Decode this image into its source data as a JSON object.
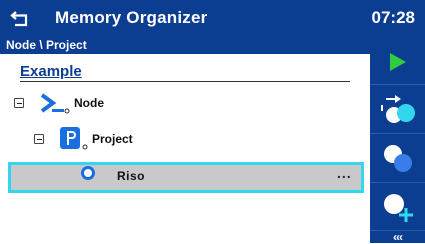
{
  "header": {
    "title": "Memory Organizer",
    "time": "07:28"
  },
  "breadcrumb": "Node \\ Project",
  "main": {
    "heading": "Example",
    "tree": [
      {
        "label": "Node"
      },
      {
        "label": "Project"
      },
      {
        "label": "Riso",
        "more": "..."
      }
    ]
  },
  "sidebar": {
    "buttons": [
      "play-icon",
      "move-node-icon",
      "copy-node-icon",
      "add-node-icon",
      "more-icon"
    ],
    "more_label": "‹‹‹"
  },
  "colors": {
    "bar": "#0b3d91",
    "accent_green": "#2ecc40",
    "highlight_border": "#33d6ee",
    "selected_bg": "#c9c9c9"
  }
}
